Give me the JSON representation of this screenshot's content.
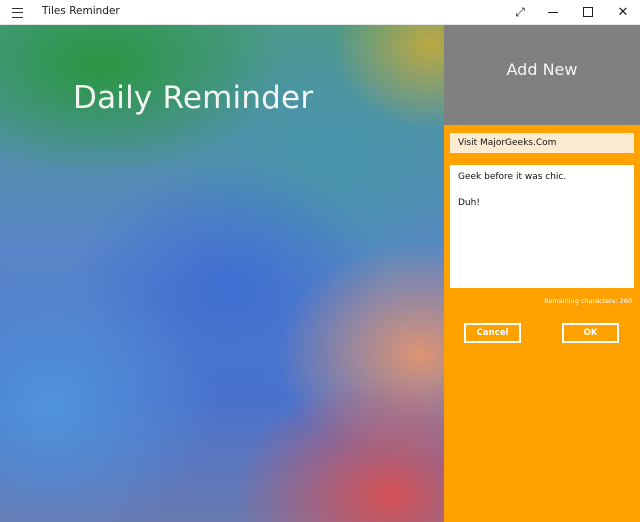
{
  "window": {
    "app_title": "Tiles Reminder",
    "controls": {
      "menu_icon": "hamburger-icon",
      "expand_icon": "expand-diagonal-icon",
      "minimize_icon": "minimize-icon",
      "maximize_icon": "maximize-icon",
      "close_icon": "close-icon"
    }
  },
  "main": {
    "heading": "Daily Reminder"
  },
  "panel": {
    "header_label": "Add New",
    "title_value": "Visit MajorGeeks.Com",
    "message_value": "Geek before it was chic.\n\nDuh!",
    "remaining_label": "Remaining characters: 260",
    "cancel_label": "Cancel",
    "ok_label": "OK"
  },
  "colors": {
    "accent": "#ffa200",
    "header_gray": "#808080",
    "title_input_bg": "#fcebd0"
  }
}
